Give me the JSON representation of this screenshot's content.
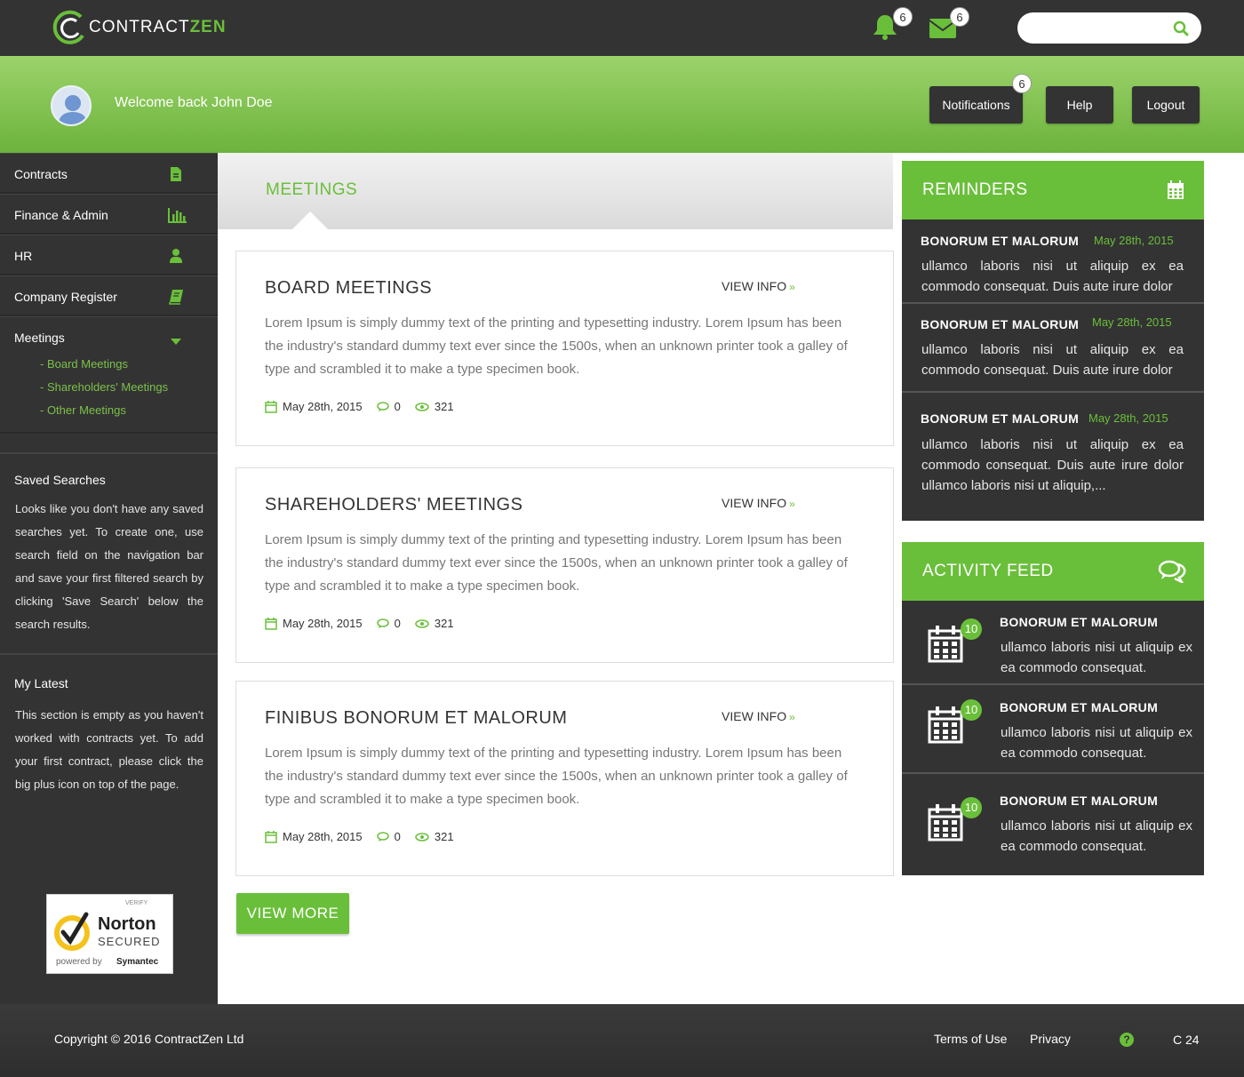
{
  "brand": {
    "name_part1": "CONTRACT",
    "name_part2": "ZEN",
    "accent": "#6abf3a",
    "dark": "#333333"
  },
  "topbar": {
    "bell_count": "6",
    "mail_count": "6",
    "search": {
      "placeholder": "",
      "value": ""
    }
  },
  "header": {
    "welcome": "Welcome back John Doe",
    "notifications_label": "Notifications",
    "notifications_count": "6",
    "help_label": "Help",
    "logout_label": "Logout"
  },
  "sidebar": {
    "items": [
      {
        "label": "Contracts",
        "icon": "file-icon"
      },
      {
        "label": "Finance & Admin",
        "icon": "bar-chart-icon"
      },
      {
        "label": "HR",
        "icon": "user-icon"
      },
      {
        "label": "Company Register",
        "icon": "book-icon"
      },
      {
        "label": "Meetings",
        "icon": "caret-down-icon"
      }
    ],
    "sub_items": [
      "- Board Meetings",
      "- Shareholders' Meetings",
      "- Other Meetings"
    ],
    "saved_searches": {
      "title": "Saved Searches",
      "text": "Looks like you don't have any saved searches yet. To create one, use search field on the navigation bar and save your first filtered search by clicking 'Save Search' below the search results."
    },
    "my_latest": {
      "title": "My Latest",
      "text": "This section is empty as you haven't worked with contracts yet. To add your first contract, please click the big plus icon on top of the page."
    },
    "norton": {
      "verify": "VERIFY",
      "name": "Norton",
      "secured": "SECURED",
      "powered": "powered by",
      "symantec": "Symantec"
    }
  },
  "main": {
    "title": "MEETINGS",
    "view_info_label": "VIEW INFO",
    "cards": [
      {
        "title": "BOARD MEETINGS",
        "body": "Lorem Ipsum is simply dummy text of the printing and typesetting industry. Lorem Ipsum has been the industry's standard dummy text ever since the 1500s, when an unknown printer took a galley of type and scrambled it to make a type specimen book.",
        "date": "May 28th, 2015",
        "comments": "0",
        "views": "321"
      },
      {
        "title": "SHAREHOLDERS' MEETINGS",
        "body": "Lorem Ipsum is simply dummy text of the printing and typesetting industry. Lorem Ipsum has been the industry's standard dummy text ever since the 1500s, when an unknown printer took a galley of type and scrambled it to make a type specimen book.",
        "date": "May 28th, 2015",
        "comments": "0",
        "views": "321"
      },
      {
        "title": "FINIBUS BONORUM ET MALORUM",
        "body": "Lorem Ipsum is simply dummy text of the printing and typesetting industry. Lorem Ipsum has been the industry's standard dummy text ever since the 1500s, when an unknown printer took a galley of type and scrambled it to make a type specimen book.",
        "date": "May 28th, 2015",
        "comments": "0",
        "views": "321"
      }
    ],
    "view_more_label": "VIEW MORE"
  },
  "reminders": {
    "title": "REMINDERS",
    "items": [
      {
        "title": "BONORUM ET MALORUM",
        "date": "May 28th, 2015",
        "body": "ullamco laboris nisi ut aliquip ex ea commodo consequat. Duis aute irure dolor"
      },
      {
        "title": "BONORUM ET MALORUM",
        "date": "May 28th, 2015",
        "body": "ullamco laboris nisi ut aliquip ex ea commodo consequat. Duis aute irure dolor"
      },
      {
        "title": "BONORUM ET MALORUM",
        "date": "May 28th, 2015",
        "body": "ullamco laboris nisi ut aliquip ex ea commodo consequat. Duis aute irure dolor  ullamco laboris nisi ut aliquip,..."
      }
    ]
  },
  "activity_feed": {
    "title": "ACTIVITY FEED",
    "items": [
      {
        "badge": "10",
        "title": "BONORUM ET MALORUM",
        "body": "ullamco laboris nisi ut aliquip ex ea commodo consequat."
      },
      {
        "badge": "10",
        "title": "BONORUM ET MALORUM",
        "body": "ullamco laboris nisi ut aliquip ex ea commodo consequat."
      },
      {
        "badge": "10",
        "title": "BONORUM ET MALORUM",
        "body": "ullamco laboris nisi ut aliquip ex ea commodo consequat."
      }
    ]
  },
  "footer": {
    "copyright": "Copyright © 2016 ContractZen Ltd",
    "terms": "Terms of Use",
    "privacy": "Privacy",
    "version": "C 24"
  }
}
